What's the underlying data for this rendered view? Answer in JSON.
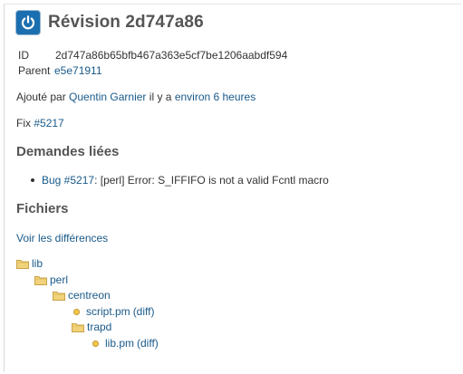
{
  "revision": {
    "title": "Révision 2d747a86",
    "id_label": "ID",
    "id_value": "2d747a86b65bfb467a363e5cf7be1206aabdf594",
    "parent_label": "Parent",
    "parent_value": "e5e71911"
  },
  "added": {
    "prefix": "Ajouté par",
    "author": "Quentin Garnier",
    "middle": "il y a",
    "time": "environ 6 heures"
  },
  "fix": {
    "prefix": "Fix",
    "issue": "#5217"
  },
  "related": {
    "heading": "Demandes liées",
    "items": [
      {
        "link": "Bug #5217",
        "text": ": [perl] Error: S_IFFIFO is not a valid Fcntl macro"
      }
    ]
  },
  "files": {
    "heading": "Fichiers",
    "view_diff": "Voir les différences",
    "tree": [
      {
        "name": "lib",
        "type": "folder",
        "depth": 0
      },
      {
        "name": "perl",
        "type": "folder",
        "depth": 1
      },
      {
        "name": "centreon",
        "type": "folder",
        "depth": 2
      },
      {
        "name": "script.pm",
        "type": "file",
        "depth": 3,
        "diff": "(diff)"
      },
      {
        "name": "trapd",
        "type": "folder",
        "depth": 3
      },
      {
        "name": "lib.pm",
        "type": "file",
        "depth": 4,
        "diff": "(diff)"
      }
    ]
  },
  "icons": {
    "avatar": "power-icon",
    "folder": "folder-icon",
    "file": "file-dot-icon"
  },
  "colors": {
    "link": "#1a5a8a",
    "heading": "#555555",
    "avatar_bg": "#1b6fb0",
    "folder": "#f0d27a"
  }
}
